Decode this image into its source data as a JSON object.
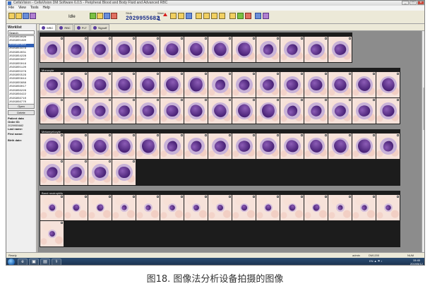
{
  "window": {
    "title": "CellaVision - CellaVision DM Software 6.0.5 - Peripheral Blood and Body Fluid and Advanced RBC",
    "controls": [
      "_",
      "□",
      "×"
    ]
  },
  "menu": [
    "File",
    "View",
    "Tools",
    "Help"
  ],
  "toolbar": {
    "status_label": "Idle",
    "slide_no_label": "Slide",
    "slide_no_value": "2029955682",
    "warning_label": "Warn",
    "warning_count": "1"
  },
  "sidebar": {
    "worklist_label": "Worklist",
    "search_placeholder": "Search",
    "samples": [
      "2029953599",
      "2029955490",
      "2029955682",
      "2029953479",
      "2029954031",
      "2029954228",
      "2029955007",
      "2029955016",
      "2029955120",
      "2029955378",
      "2029955529",
      "2029955644",
      "2029955688",
      "2029956017",
      "2029956226",
      "2029956422",
      "2029956710",
      "2029956770",
      "2029957015"
    ],
    "selected_index": 2,
    "open_button": "Open",
    "delete_button": "Delete",
    "patient_data_label": "Patient data",
    "order_id_label": "Order ID:",
    "order_id_value": "2029955682",
    "last_name_label": "Last name:",
    "first_name_label": "First name:",
    "birth_date_label": "Birth date:"
  },
  "tabs": [
    {
      "label": "WBC",
      "active": true
    },
    {
      "label": "RBC",
      "active": false
    },
    {
      "label": "PLT",
      "active": false
    },
    {
      "label": "Signoff",
      "active": false
    }
  ],
  "groups": [
    {
      "label": "",
      "cells": 13,
      "kind": "large"
    },
    {
      "label": "Monocyte",
      "cells": 30,
      "kind": "large"
    },
    {
      "label": "Metamyelocyte",
      "cells": 19,
      "kind": "large"
    },
    {
      "label": "Band neutrophils",
      "cells": 16,
      "kind": "small"
    }
  ],
  "statusbar": {
    "left": "Ready",
    "middle1": "admin",
    "middle2": "DM1200",
    "right": "NUM"
  },
  "taskbar": {
    "apps": [
      "e",
      "▣",
      "▤",
      "⚕"
    ],
    "tray": "EN  ▲ ⚑ ♪",
    "time": "15:45",
    "date": "2019/5/12"
  },
  "caption": "图18. 图像法分析设备拍摄的图像"
}
